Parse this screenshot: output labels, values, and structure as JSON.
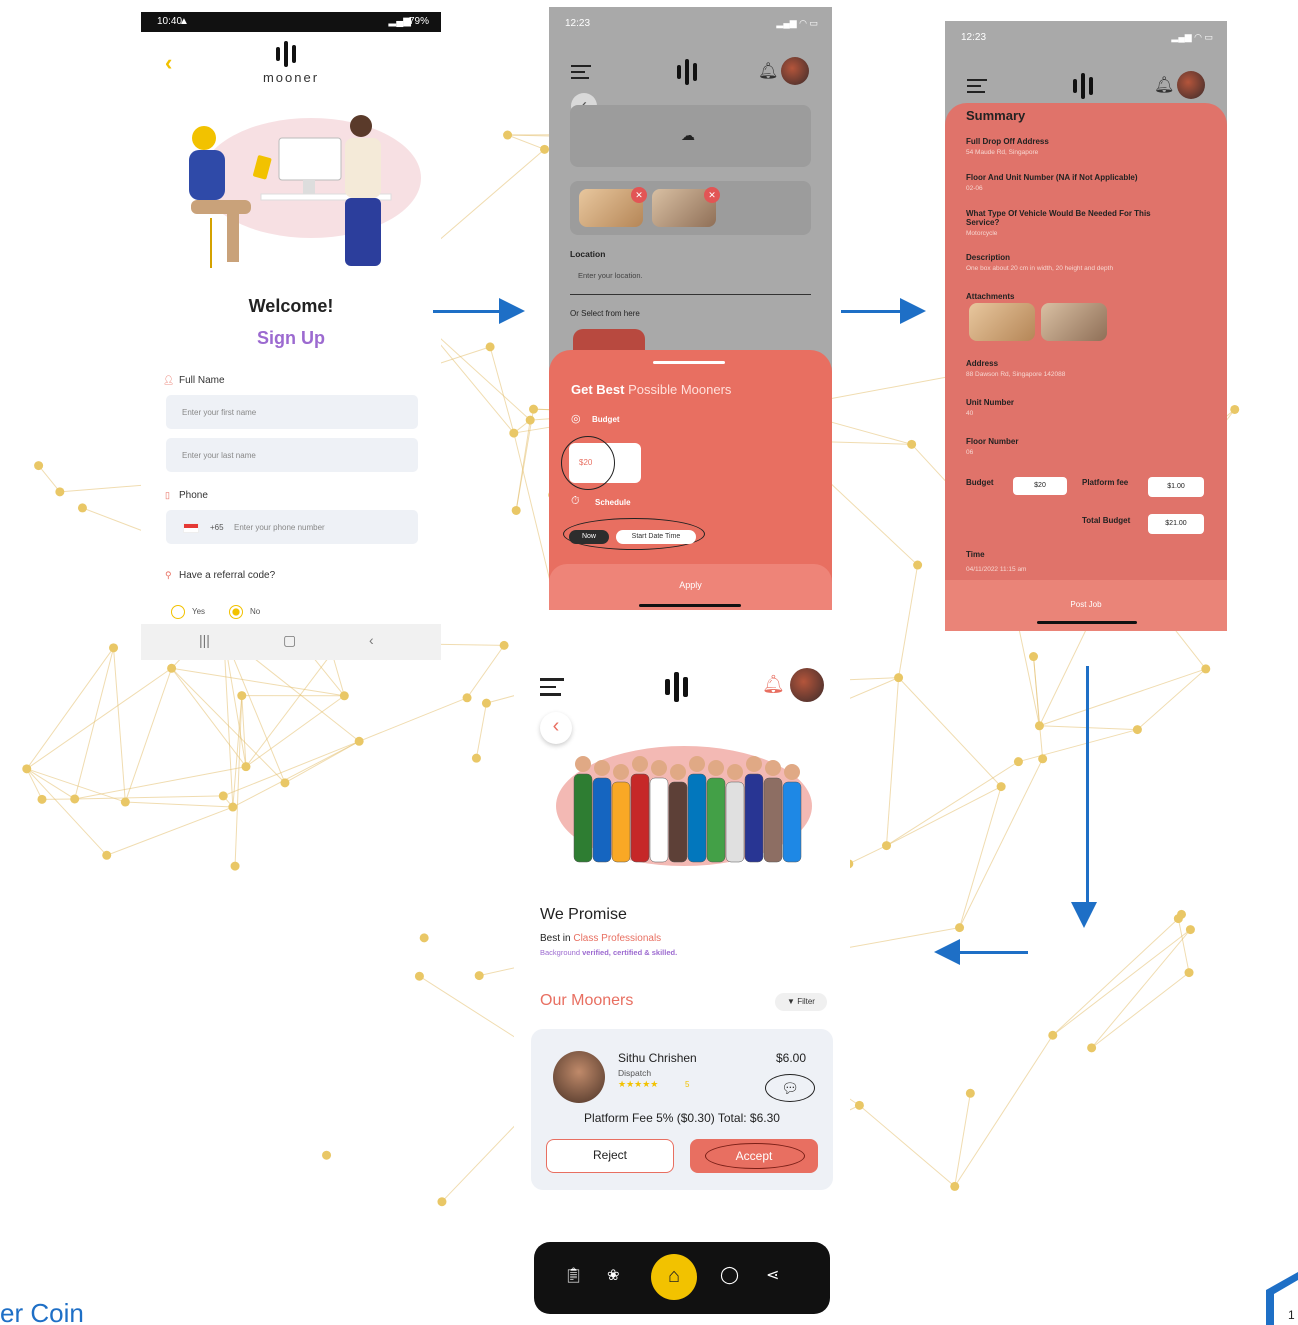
{
  "colors": {
    "accent": "#e86f61",
    "yellow": "#f2c200",
    "purple": "#9c6ad0",
    "arrow": "#1e6fc6",
    "network_gold": "#e4c070"
  },
  "screen1": {
    "status_time": "10:40",
    "status_battery": "79%",
    "brand": "mooner",
    "welcome": "Welcome!",
    "signup": "Sign Up",
    "full_name_label": "Full Name",
    "first_name_placeholder": "Enter your first name",
    "last_name_placeholder": "Enter your last name",
    "phone_label": "Phone",
    "country_code": "+65",
    "phone_placeholder": "Enter your phone number",
    "referral_question": "Have a referral code?",
    "yes": "Yes",
    "no": "No",
    "selected_option": "No",
    "nav_icons": [
      "recents-icon",
      "home-icon",
      "back-icon"
    ]
  },
  "screen2": {
    "status_time": "12:23",
    "location_label": "Location",
    "location_placeholder": "Enter your location.",
    "select_hint": "Or Select from here",
    "sheet_title_bold": "Get Best",
    "sheet_title_rest": "Possible Mooners",
    "budget_label": "Budget",
    "budget_value": "$20",
    "schedule_label": "Schedule",
    "now_btn": "Now",
    "start_time_btn": "Start Date Time",
    "apply_btn": "Apply"
  },
  "screen3": {
    "status_time": "12:23",
    "title": "Summary",
    "fields": [
      {
        "label": "Full Drop Off Address",
        "value": "54 Maude Rd, Singapore"
      },
      {
        "label": "Floor And Unit Number (NA if Not Applicable)",
        "value": "02-06"
      },
      {
        "label": "What Type Of Vehicle Would Be Needed For This Service?",
        "value": "Motorcycle"
      },
      {
        "label": "Description",
        "value": "One box about 20 cm in width,  20 height and  depth"
      }
    ],
    "attachments_label": "Attachments",
    "fields2": [
      {
        "label": "Address",
        "value": "88 Dawson Rd, Singapore 142088"
      },
      {
        "label": "Unit Number",
        "value": "40"
      },
      {
        "label": "Floor Number",
        "value": "06"
      }
    ],
    "budget_label": "Budget",
    "budget_value": "$20",
    "platform_fee_label": "Platform fee",
    "platform_fee_value": "$1.00",
    "total_budget_label": "Total Budget",
    "total_budget_value": "$21.00",
    "time_label": "Time",
    "time_value": "04/11/2022 11:15 am",
    "post_job_btn": "Post Job"
  },
  "screen4": {
    "promise_title": "We Promise",
    "promise_best": "Best in",
    "promise_class": "Class Professionals",
    "promise_bg": "Background",
    "promise_bg_rest": "verified, certified & skilled.",
    "section_title": "Our Mooners",
    "filter_btn": "Filter",
    "mooner_name": "Sithu Chrishen",
    "mooner_role": "Dispatch",
    "mooner_rating": "5",
    "mooner_price": "$6.00",
    "fee_line": "Platform Fee 5% ($0.30) Total: $6.30",
    "reject_btn": "Reject",
    "accept_btn": "Accept",
    "bottom_nav": [
      "clipboard-icon",
      "lotus-icon",
      "home-icon",
      "chat-icon",
      "share-icon"
    ]
  },
  "footer": {
    "brand_fragment": "er Coin",
    "page_number": "1"
  }
}
